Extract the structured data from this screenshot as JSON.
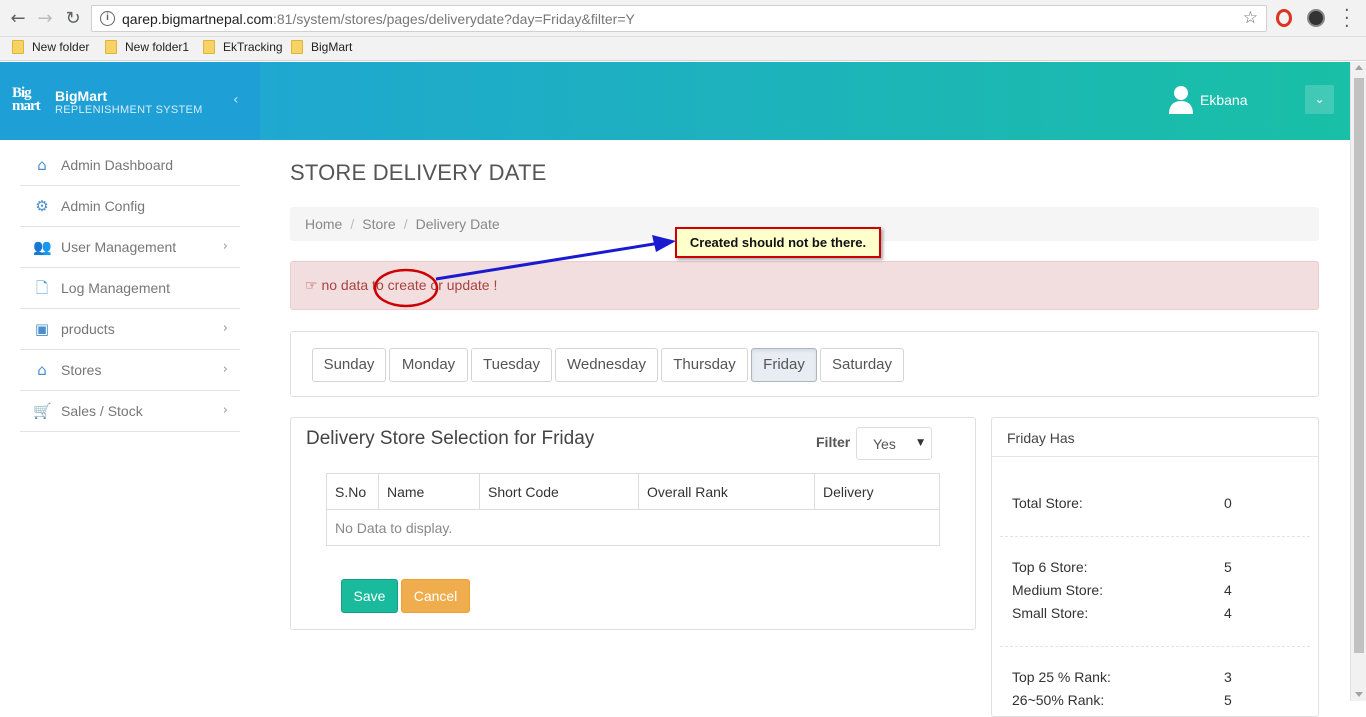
{
  "browser": {
    "url_host": "qarep.bigmartnepal.com",
    "url_rest": ":81/system/stores/pages/deliverydate?day=Friday&filter=Y",
    "bookmarks": [
      "New folder",
      "New folder1",
      "EkTracking",
      "BigMart"
    ]
  },
  "brand": {
    "logo": "BigMart",
    "title": "BigMart",
    "subtitle": "REPLENISHMENT SYSTEM"
  },
  "user": {
    "name": "Ekbana"
  },
  "sidebar": {
    "items": [
      {
        "label": "Admin Dashboard",
        "icon": "home-icon",
        "has_sub": false
      },
      {
        "label": "Admin Config",
        "icon": "gear-icon",
        "has_sub": false
      },
      {
        "label": "User Management",
        "icon": "users-icon",
        "has_sub": true
      },
      {
        "label": "Log Management",
        "icon": "file-icon",
        "has_sub": false
      },
      {
        "label": "products",
        "icon": "briefcase-icon",
        "has_sub": true
      },
      {
        "label": "Stores",
        "icon": "home-icon",
        "has_sub": true
      },
      {
        "label": "Sales / Stock",
        "icon": "cart-icon",
        "has_sub": true
      }
    ]
  },
  "page": {
    "title": "STORE DELIVERY DATE",
    "breadcrumb": [
      "Home",
      "Store",
      "Delivery Date"
    ],
    "alert": "no data to create or update !",
    "annotation": "Created should not be there."
  },
  "days": {
    "items": [
      "Sunday",
      "Monday",
      "Tuesday",
      "Wednesday",
      "Thursday",
      "Friday",
      "Saturday"
    ],
    "active": "Friday"
  },
  "selection": {
    "title": "Delivery Store Selection for Friday",
    "filter_label": "Filter",
    "filter_value": "Yes",
    "columns": [
      "S.No",
      "Name",
      "Short Code",
      "Overall Rank",
      "Delivery"
    ],
    "empty_text": "No Data to display.",
    "save_label": "Save",
    "cancel_label": "Cancel"
  },
  "summary": {
    "title": "Friday Has",
    "total": {
      "label": "Total Store:",
      "value": "0"
    },
    "group1": [
      {
        "label": "Top 6 Store:",
        "value": "5"
      },
      {
        "label": "Medium Store:",
        "value": "4"
      },
      {
        "label": "Small Store:",
        "value": "4"
      }
    ],
    "group2": [
      {
        "label": "Top 25 % Rank:",
        "value": "3"
      },
      {
        "label": "26~50% Rank:",
        "value": "5"
      }
    ]
  },
  "colors": {
    "brand_blue": "#1e9fd6",
    "header_teal": "#19bfa6",
    "alert_bg": "#f2dede",
    "save_green": "#1abb9c",
    "cancel_orange": "#f0ad4e"
  }
}
